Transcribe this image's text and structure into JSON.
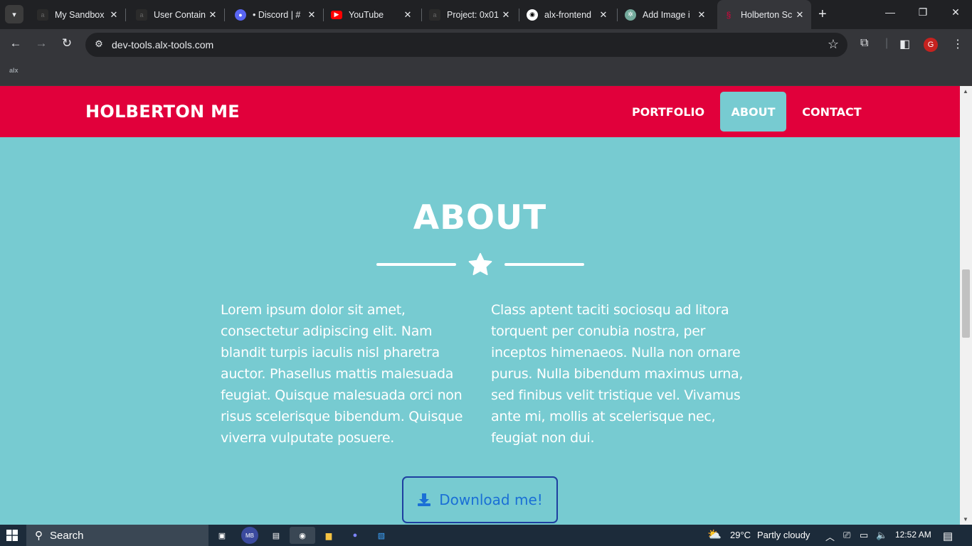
{
  "browser": {
    "tabs": [
      {
        "title": "My Sandbox",
        "favicon": "alx-icon"
      },
      {
        "title": "User Contain",
        "favicon": "alx-icon"
      },
      {
        "title": "• Discord | #",
        "favicon": "discord-icon"
      },
      {
        "title": "YouTube",
        "favicon": "youtube-icon"
      },
      {
        "title": "Project: 0x01",
        "favicon": "alx-icon"
      },
      {
        "title": "alx-frontend",
        "favicon": "github-icon"
      },
      {
        "title": "Add Image i",
        "favicon": "chatgpt-icon"
      },
      {
        "title": "Holberton Sc",
        "favicon": "holberton-icon"
      }
    ],
    "url": "dev-tools.alx-tools.com",
    "profile_initial": "G",
    "bookmark": "alx"
  },
  "site": {
    "brand": "HOLBERTON ME",
    "nav": [
      "PORTFOLIO",
      "ABOUT",
      "CONTACT"
    ],
    "active_nav": "ABOUT",
    "section_title": "ABOUT",
    "paragraph_left": "Lorem ipsum dolor sit amet, consectetur adipiscing elit. Nam blandit turpis iaculis nisl pharetra auctor. Phasellus mattis malesuada feugiat. Quisque malesuada orci non risus scelerisque bibendum. Quisque viverra vulputate posuere.",
    "paragraph_right": "Class aptent taciti sociosqu ad litora torquent per conubia nostra, per inceptos himenaeos. Nulla non ornare purus. Nulla bibendum maximus urna, sed finibus velit tristique vel. Vivamus ante mi, mollis at scelerisque nec, feugiat non dui.",
    "download_label": "Download me!",
    "colors": {
      "header": "#e1003b",
      "section": "#77cbd1",
      "button_border": "#1e3fa0",
      "button_text": "#1a6fd6"
    }
  },
  "taskbar": {
    "search_placeholder": "Search",
    "weather_temp": "29°C",
    "weather_desc": "Partly cloudy",
    "time": "12:52 AM"
  }
}
